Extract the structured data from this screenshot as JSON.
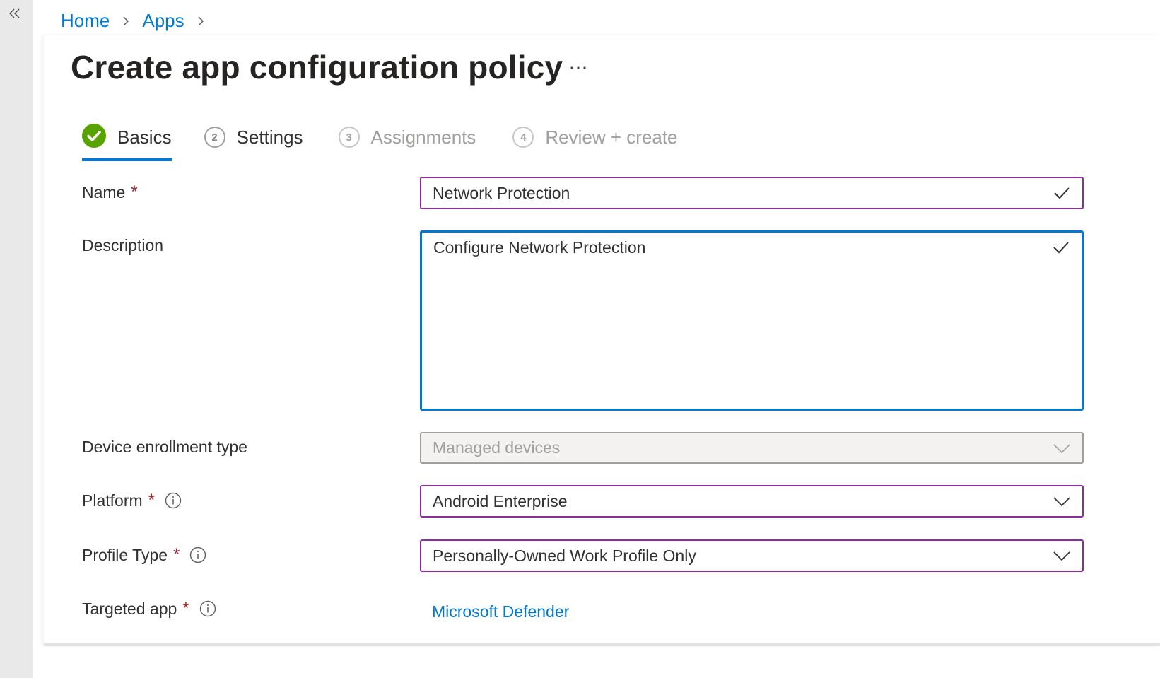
{
  "nav": {
    "collapse_icon": "double-chevron-left-icon"
  },
  "breadcrumb": {
    "items": [
      {
        "label": "Home"
      },
      {
        "label": "Apps"
      }
    ]
  },
  "header": {
    "title": "Create app configuration policy",
    "more_label": "···"
  },
  "wizard": {
    "steps": [
      {
        "number": "1",
        "label": "Basics",
        "state": "completed"
      },
      {
        "number": "2",
        "label": "Settings",
        "state": "next"
      },
      {
        "number": "3",
        "label": "Assignments",
        "state": "pending"
      },
      {
        "number": "4",
        "label": "Review + create",
        "state": "pending"
      }
    ]
  },
  "form": {
    "required_mark": "*",
    "name": {
      "label": "Name",
      "value": "Network Protection",
      "required": true
    },
    "description": {
      "label": "Description",
      "value": "Configure Network Protection"
    },
    "enrollment": {
      "label": "Device enrollment type",
      "value": "Managed devices",
      "disabled": true
    },
    "platform": {
      "label": "Platform",
      "value": "Android Enterprise",
      "required": true
    },
    "profile_type": {
      "label": "Profile Type",
      "value": "Personally-Owned Work Profile Only",
      "required": true
    },
    "targeted_app": {
      "label": "Targeted app",
      "value": "Microsoft Defender",
      "required": true
    }
  },
  "colors": {
    "accent": "#0078d4",
    "valid_border": "#8e2ba0",
    "success": "#57a300",
    "required": "#a4262c"
  }
}
